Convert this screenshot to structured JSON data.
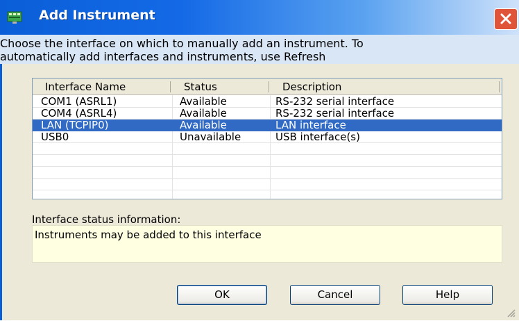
{
  "window": {
    "title": "Add Instrument",
    "title_icon": "instrument-icon",
    "close_icon": "close-icon"
  },
  "instructions": {
    "line1": "Choose the interface on which to manually add an instrument.  To",
    "line2": "automatically add interfaces and instruments, use Refresh"
  },
  "table": {
    "columns": [
      "Interface Name",
      "Status",
      "Description"
    ],
    "rows": [
      {
        "name": "COM1 (ASRL1)",
        "status": "Available",
        "description": "RS-232 serial interface",
        "selected": false
      },
      {
        "name": "COM4 (ASRL4)",
        "status": "Available",
        "description": "RS-232 serial interface",
        "selected": false
      },
      {
        "name": "LAN (TCPIP0)",
        "status": "Available",
        "description": "LAN interface",
        "selected": true
      },
      {
        "name": "USB0",
        "status": "Unavailable",
        "description": "USB interface(s)",
        "selected": false
      }
    ]
  },
  "status": {
    "label": "Interface status information:",
    "text": "Instruments may be added to this interface"
  },
  "buttons": {
    "ok": "OK",
    "cancel": "Cancel",
    "help": "Help"
  },
  "colors": {
    "selection": "#316ac5",
    "status_background": "#ffffe1",
    "title_bar": "#0a5fd8"
  }
}
